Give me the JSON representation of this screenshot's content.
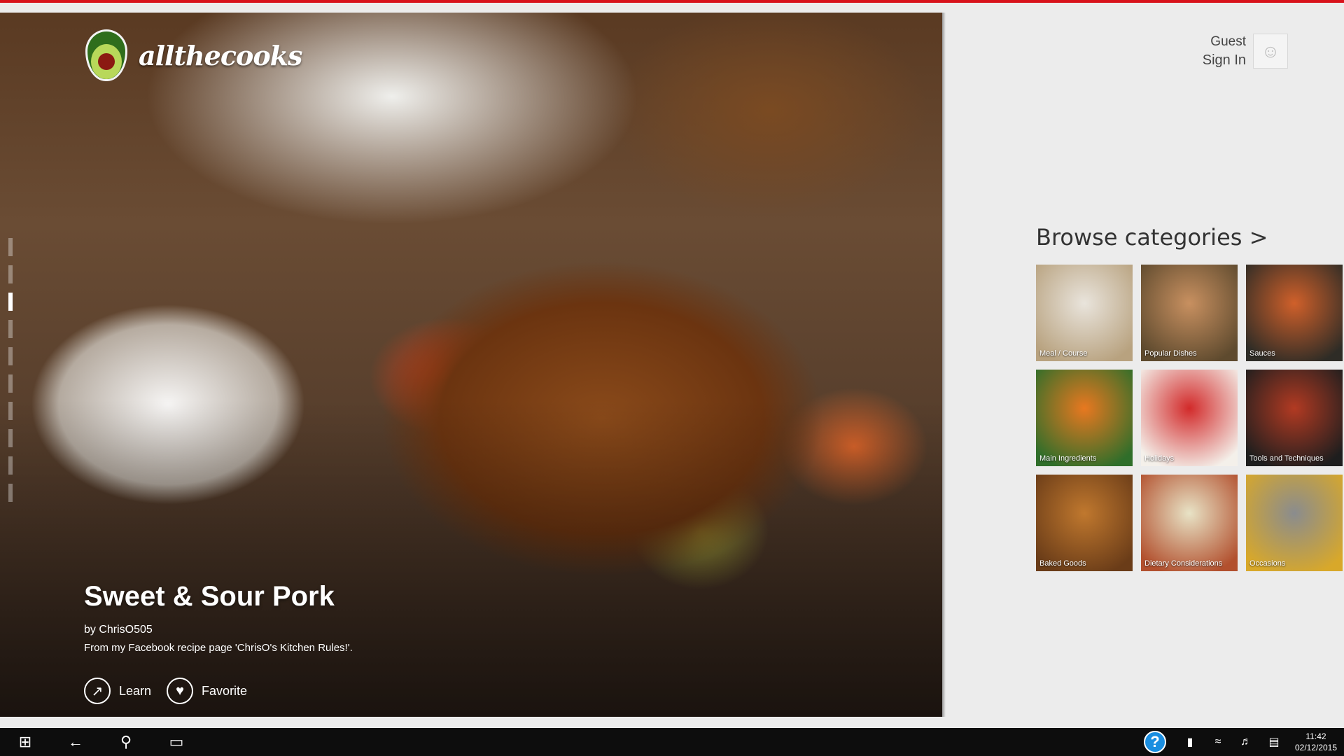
{
  "app": {
    "name": "allthecooks",
    "accent": "#d8121b"
  },
  "hero": {
    "title": "Sweet & Sour Pork",
    "author": "by ChrisO505",
    "description": "From my Facebook recipe page 'ChrisO's Kitchen Rules!'.",
    "actions": [
      {
        "label": "Learn",
        "icon": "arrow-up-right-icon"
      },
      {
        "label": "Favorite",
        "icon": "heart-icon"
      }
    ],
    "pager": {
      "count": 10,
      "active_index": 2
    }
  },
  "user": {
    "name": "Guest",
    "signin_label": "Sign In",
    "avatar_icon": "chef-hat-icon"
  },
  "browse": {
    "title": "Browse categories >",
    "categories": [
      {
        "label": "Meal / Course",
        "colors": [
          "#e9e4dc",
          "#b8a27f"
        ]
      },
      {
        "label": "Popular Dishes",
        "colors": [
          "#c89060",
          "#5e4a2e"
        ]
      },
      {
        "label": "Sauces",
        "colors": [
          "#d0602a",
          "#2e2c26"
        ]
      },
      {
        "label": "Main Ingredients",
        "colors": [
          "#e87820",
          "#2f6e2a"
        ]
      },
      {
        "label": "Holidays",
        "colors": [
          "#d22a2a",
          "#f4f0ea"
        ]
      },
      {
        "label": "Tools and Techniques",
        "colors": [
          "#b23a22",
          "#1e1e1e"
        ]
      },
      {
        "label": "Baked Goods",
        "colors": [
          "#c0782e",
          "#6a3c18"
        ]
      },
      {
        "label": "Dietary Considerations",
        "colors": [
          "#e8e3c6",
          "#b2502e"
        ]
      },
      {
        "label": "Occasions",
        "colors": [
          "#8a8c8e",
          "#d8a82a"
        ]
      }
    ]
  },
  "taskbar": {
    "time": "11:42",
    "date": "02/12/2015",
    "help_label": "?"
  }
}
